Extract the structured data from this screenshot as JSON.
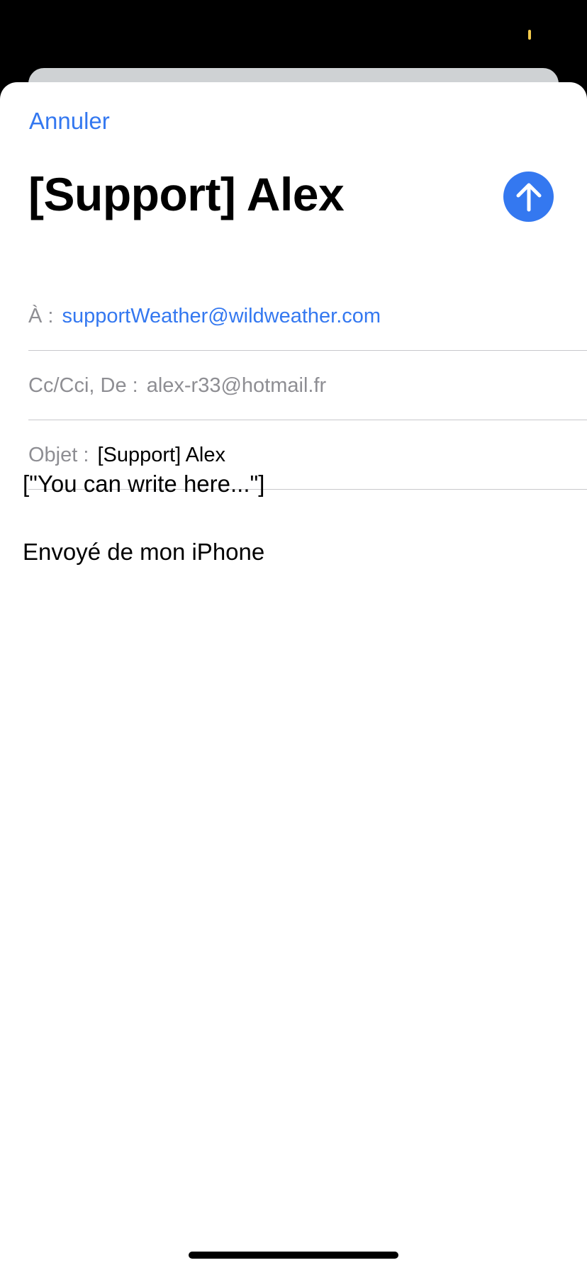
{
  "header": {
    "cancel_label": "Annuler",
    "title": "[Support] Alex",
    "send_icon": "arrow-up-icon"
  },
  "fields": {
    "to": {
      "label": "À :",
      "value": "supportWeather@wildweather.com"
    },
    "cc": {
      "label": "Cc/Cci, De :",
      "value": "alex-r33@hotmail.fr"
    },
    "subject": {
      "label": "Objet :",
      "value": "[Support] Alex"
    }
  },
  "body": {
    "text": "[\"You can write here...\"]",
    "signature": "Envoyé de mon iPhone"
  },
  "colors": {
    "accent": "#3478f0",
    "secondary_text": "#8e8e93",
    "status_indicator": "#f2c94c"
  }
}
